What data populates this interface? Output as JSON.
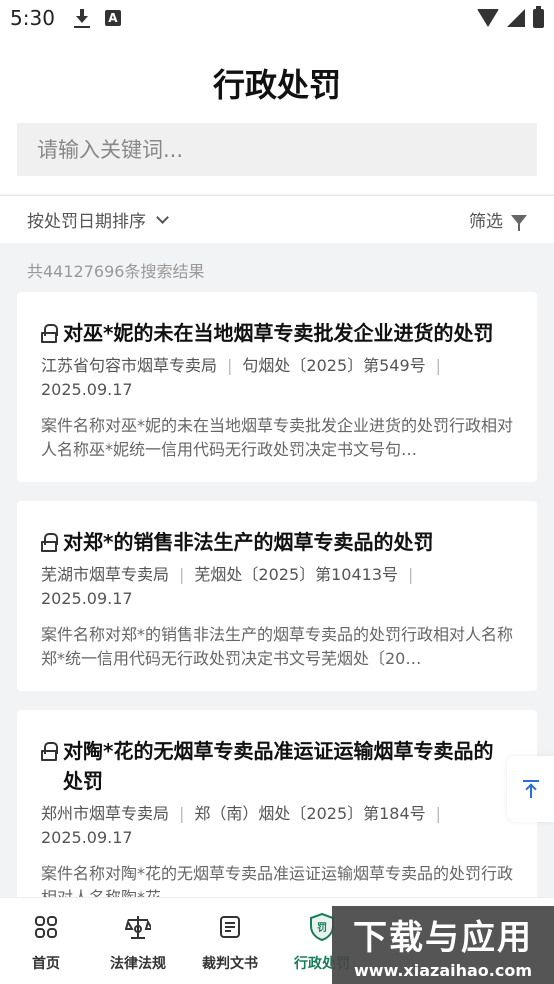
{
  "status_bar": {
    "time": "5:30",
    "a_label": "A"
  },
  "header": {
    "title": "行政处罚",
    "search_placeholder": "请输入关键词..."
  },
  "filter_bar": {
    "sort_label": "按处罚日期排序",
    "filter_label": "筛选"
  },
  "result_count": "共44127696条搜索结果",
  "results": [
    {
      "title": "对巫*妮的未在当地烟草专卖批发企业进货的处罚",
      "agency": "江苏省句容市烟草专卖局",
      "doc_no": "句烟处〔2025〕第549号",
      "date": "2025.09.17",
      "desc": "案件名称对巫*妮的未在当地烟草专卖批发企业进货的处罚行政相对人名称巫*妮统一信用代码无行政处罚决定书文号句…"
    },
    {
      "title": "对郑*的销售非法生产的烟草专卖品的处罚",
      "agency": "芜湖市烟草专卖局",
      "doc_no": "芜烟处〔2025〕第10413号",
      "date": "2025.09.17",
      "desc": "案件名称对郑*的销售非法生产的烟草专卖品的处罚行政相对人名称郑*统一信用代码无行政处罚决定书文号芜烟处〔20…"
    },
    {
      "title": "对陶*花的无烟草专卖品准运证运输烟草专卖品的处罚",
      "agency": "郑州市烟草专卖局",
      "doc_no": "郑（南）烟处〔2025〕第184号",
      "date": "2025.09.17",
      "desc": "案件名称对陶*花的无烟草专卖品准运证运输烟草专卖品的处罚行政相对人名称陶*花"
    }
  ],
  "bottom_nav": [
    {
      "label": "首页",
      "icon": "grid-icon"
    },
    {
      "label": "法律法规",
      "icon": "law-icon"
    },
    {
      "label": "裁判文书",
      "icon": "document-icon"
    },
    {
      "label": "行政处罚",
      "icon": "penalty-shield-icon"
    }
  ],
  "watermark": {
    "title": "下载与应用",
    "url": "www.xiazaihao.com"
  },
  "colors": {
    "accent_green": "#1b7c5a",
    "scroll_top_blue": "#2a6fd6"
  }
}
